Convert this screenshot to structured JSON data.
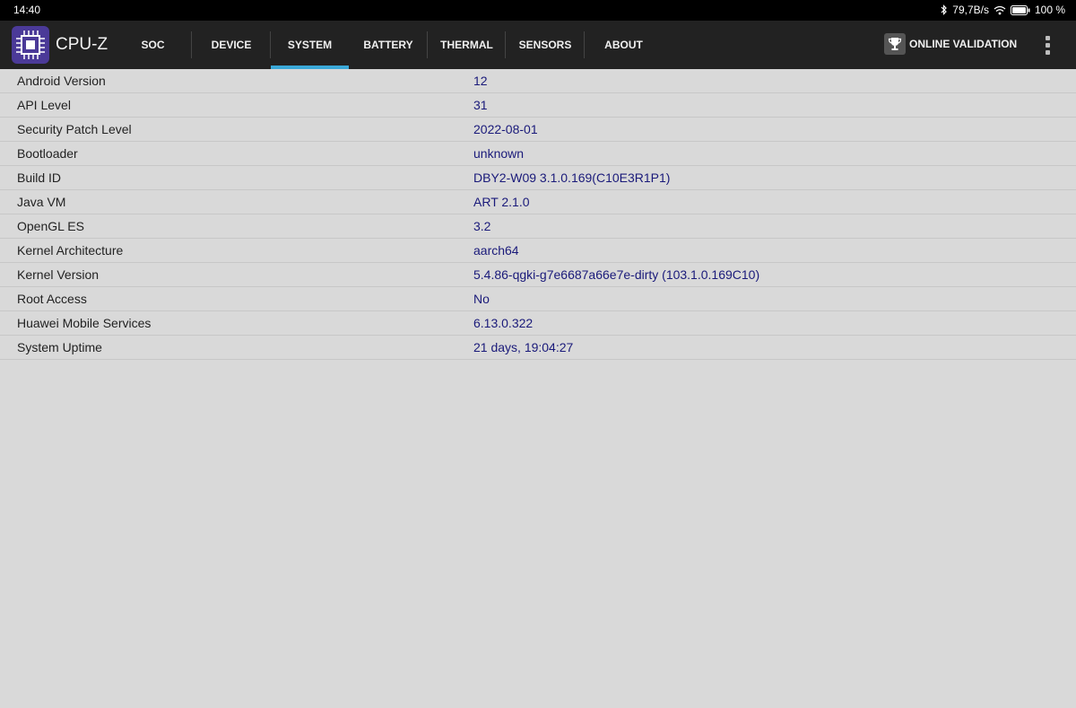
{
  "status_bar": {
    "time": "14:40",
    "network_speed": "79,7B/s",
    "battery": "100 %",
    "icons": [
      "bluetooth-icon",
      "wifi-icon",
      "battery-icon"
    ]
  },
  "app": {
    "title": "CPU-Z",
    "logo_icon": "cpu-chip-icon"
  },
  "tabs": [
    {
      "label": "SOC",
      "active": false
    },
    {
      "label": "DEVICE",
      "active": false
    },
    {
      "label": "SYSTEM",
      "active": true
    },
    {
      "label": "BATTERY",
      "active": false
    },
    {
      "label": "THERMAL",
      "active": false
    },
    {
      "label": "SENSORS",
      "active": false
    },
    {
      "label": "ABOUT",
      "active": false
    }
  ],
  "actions": {
    "validation_label": "ONLINE VALIDATION",
    "validation_icon": "trophy-icon",
    "menu_icon": "more-vertical-icon"
  },
  "colors": {
    "accent": "#3aa8d8",
    "value_text": "#1a1a7a",
    "appbar": "#222222",
    "background": "#d9d9d9"
  },
  "system_info": [
    {
      "label": "Android Version",
      "value": "12"
    },
    {
      "label": "API Level",
      "value": "31"
    },
    {
      "label": "Security Patch Level",
      "value": "2022-08-01"
    },
    {
      "label": "Bootloader",
      "value": "unknown"
    },
    {
      "label": "Build ID",
      "value": "DBY2-W09 3.1.0.169(C10E3R1P1)"
    },
    {
      "label": "Java VM",
      "value": "ART 2.1.0"
    },
    {
      "label": "OpenGL ES",
      "value": "3.2"
    },
    {
      "label": "Kernel Architecture",
      "value": "aarch64"
    },
    {
      "label": "Kernel Version",
      "value": "5.4.86-qgki-g7e6687a66e7e-dirty (103.1.0.169C10)"
    },
    {
      "label": "Root Access",
      "value": "No"
    },
    {
      "label": "Huawei Mobile Services",
      "value": "6.13.0.322"
    },
    {
      "label": "System Uptime",
      "value": "21 days, 19:04:27"
    }
  ]
}
